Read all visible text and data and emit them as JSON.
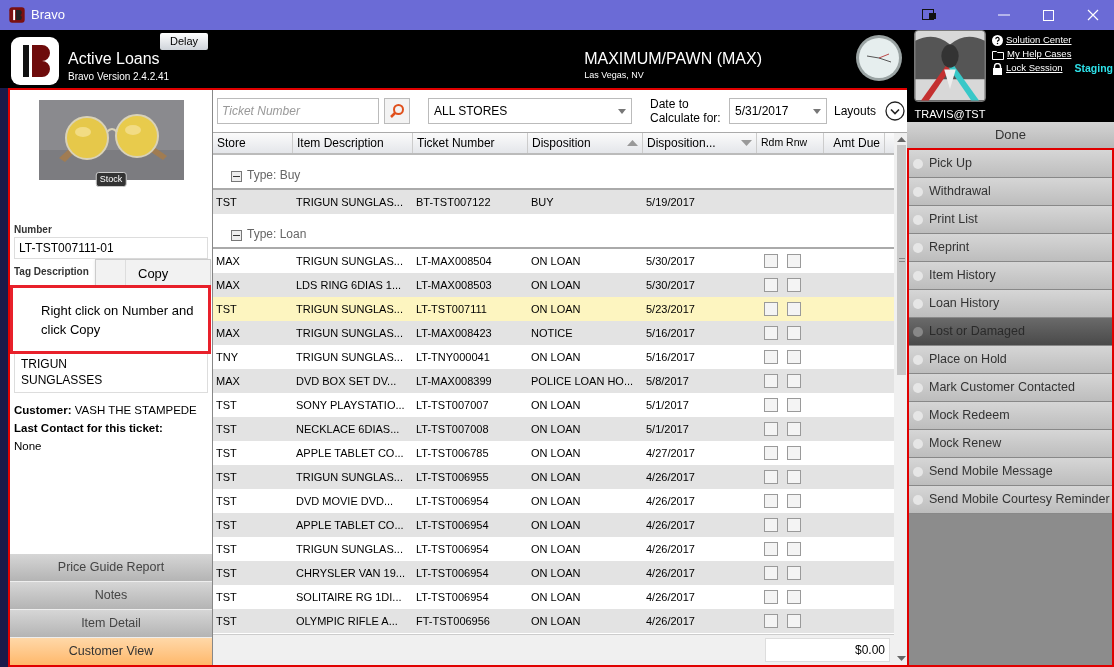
{
  "window": {
    "title": "Bravo"
  },
  "header": {
    "app_title": "Active Loans",
    "version": "Bravo Version 2.4.2.41",
    "delay_button": "Delay",
    "store_name": "MAXIMUM/PAWN (MAX)",
    "store_location": "Las Vegas, NV",
    "user": "TRAVIS@TST",
    "environment": "Staging",
    "links": [
      {
        "label": "Solution Center"
      },
      {
        "label": "My Help Cases"
      },
      {
        "label": "Lock Session"
      }
    ]
  },
  "item_panel": {
    "photo_badge": "Stock",
    "number_label": "Number",
    "number": "LT-TST007111-01",
    "tag_label": "Tag Description",
    "tag_description": [
      "TRIGUN",
      "SUNGLASSES"
    ],
    "customer_label": "Customer:",
    "customer": "VASH THE STAMPEDE",
    "last_contact_label": "Last Contact for this ticket:",
    "last_contact": "None"
  },
  "context_menu": {
    "items": [
      "Copy"
    ]
  },
  "annotation": "Right click on Number and click Copy",
  "left_buttons": [
    {
      "label": "Price Guide Report",
      "selected": false
    },
    {
      "label": "Notes",
      "selected": false
    },
    {
      "label": "Item Detail",
      "selected": false
    },
    {
      "label": "Customer View",
      "selected": true
    }
  ],
  "toolbar": {
    "ticket_placeholder": "Ticket Number",
    "store_filter": "ALL STORES",
    "date_label": "Date to Calculate for:",
    "date": "5/31/2017",
    "layouts_label": "Layouts"
  },
  "table": {
    "columns": [
      {
        "label": "Store",
        "sorted": false
      },
      {
        "label": "Item Description",
        "sorted": false
      },
      {
        "label": "Ticket Number",
        "sorted": false
      },
      {
        "label": "Disposition",
        "sorted": true,
        "descending": false
      },
      {
        "label": "Disposition...",
        "sorted": true,
        "descending": true
      },
      {
        "label": "Rdm Rnw",
        "sorted": false
      },
      {
        "label": "Amt Due",
        "sorted": false
      }
    ],
    "groups": [
      {
        "label": "Type: Buy",
        "expanded": true,
        "rows": [
          {
            "store": "TST",
            "item": "TRIGUN SUNGLAS...",
            "ticket": "BT-TST007122",
            "disposition": "BUY",
            "date": "5/19/2017",
            "selected": false
          }
        ]
      },
      {
        "label": "Type: Loan",
        "expanded": true,
        "rows": [
          {
            "store": "MAX",
            "item": "TRIGUN SUNGLAS...",
            "ticket": "LT-MAX008504",
            "disposition": "ON LOAN",
            "date": "5/30/2017",
            "selected": false,
            "redeem": false,
            "renew": false
          },
          {
            "store": "MAX",
            "item": "LDS RING 6DIAS 1...",
            "ticket": "LT-MAX008503",
            "disposition": "ON LOAN",
            "date": "5/30/2017",
            "selected": false,
            "redeem": false,
            "renew": false
          },
          {
            "store": "TST",
            "item": "TRIGUN SUNGLAS...",
            "ticket": "LT-TST007111",
            "disposition": "ON LOAN",
            "date": "5/23/2017",
            "selected": true,
            "redeem": false,
            "renew": false
          },
          {
            "store": "MAX",
            "item": "TRIGUN SUNGLAS...",
            "ticket": "LT-MAX008423",
            "disposition": "NOTICE",
            "date": "5/16/2017",
            "selected": false,
            "redeem": false,
            "renew": false
          },
          {
            "store": "TNY",
            "item": "TRIGUN SUNGLAS...",
            "ticket": "LT-TNY000041",
            "disposition": "ON LOAN",
            "date": "5/16/2017",
            "selected": false,
            "redeem": false,
            "renew": false
          },
          {
            "store": "MAX",
            "item": "DVD BOX SET DV...",
            "ticket": "LT-MAX008399",
            "disposition": "POLICE LOAN HO...",
            "date": "5/8/2017",
            "selected": false,
            "redeem": false,
            "renew": false
          },
          {
            "store": "TST",
            "item": "SONY PLAYSTATIO...",
            "ticket": "LT-TST007007",
            "disposition": "ON LOAN",
            "date": "5/1/2017",
            "selected": false,
            "redeem": false,
            "renew": false
          },
          {
            "store": "TST",
            "item": "NECKLACE 6DIAS...",
            "ticket": "LT-TST007008",
            "disposition": "ON LOAN",
            "date": "5/1/2017",
            "selected": false,
            "redeem": false,
            "renew": false
          },
          {
            "store": "TST",
            "item": "APPLE TABLET CO...",
            "ticket": "LT-TST006785",
            "disposition": "ON LOAN",
            "date": "4/27/2017",
            "selected": false,
            "redeem": false,
            "renew": false
          },
          {
            "store": "TST",
            "item": "TRIGUN SUNGLAS...",
            "ticket": "LT-TST006955",
            "disposition": "ON LOAN",
            "date": "4/26/2017",
            "selected": false,
            "redeem": false,
            "renew": false
          },
          {
            "store": "TST",
            "item": "DVD MOVIE DVD...",
            "ticket": "LT-TST006954",
            "disposition": "ON LOAN",
            "date": "4/26/2017",
            "selected": false,
            "redeem": false,
            "renew": false
          },
          {
            "store": "TST",
            "item": "APPLE TABLET CO...",
            "ticket": "LT-TST006954",
            "disposition": "ON LOAN",
            "date": "4/26/2017",
            "selected": false,
            "redeem": false,
            "renew": false
          },
          {
            "store": "TST",
            "item": "TRIGUN SUNGLAS...",
            "ticket": "LT-TST006954",
            "disposition": "ON LOAN",
            "date": "4/26/2017",
            "selected": false,
            "redeem": false,
            "renew": false
          },
          {
            "store": "TST",
            "item": "CHRYSLER VAN 19...",
            "ticket": "LT-TST006954",
            "disposition": "ON LOAN",
            "date": "4/26/2017",
            "selected": false,
            "redeem": false,
            "renew": false
          },
          {
            "store": "TST",
            "item": "SOLITAIRE RG 1DI...",
            "ticket": "LT-TST006954",
            "disposition": "ON LOAN",
            "date": "4/26/2017",
            "selected": false,
            "redeem": false,
            "renew": false
          },
          {
            "store": "TST",
            "item": "OLYMPIC RIFLE A...",
            "ticket": "FT-TST006956",
            "disposition": "ON LOAN",
            "date": "4/26/2017",
            "selected": false,
            "redeem": false,
            "renew": false
          }
        ]
      }
    ],
    "total": "$0.00"
  },
  "actions": {
    "done": "Done",
    "items": [
      {
        "label": "Pick Up",
        "disabled": false
      },
      {
        "label": "Withdrawal",
        "disabled": false
      },
      {
        "label": "Print List",
        "disabled": false
      },
      {
        "label": "Reprint",
        "disabled": false
      },
      {
        "label": "Item History",
        "disabled": false
      },
      {
        "label": "Loan History",
        "disabled": false
      },
      {
        "label": "Lost or Damaged",
        "disabled": true
      },
      {
        "label": "Place on Hold",
        "disabled": false
      },
      {
        "label": "Mark Customer Contacted",
        "disabled": false
      },
      {
        "label": "Mock Redeem",
        "disabled": false
      },
      {
        "label": "Mock Renew",
        "disabled": false
      },
      {
        "label": "Send Mobile Message",
        "disabled": false
      },
      {
        "label": "Send Mobile Courtesy Reminder",
        "disabled": false
      }
    ]
  }
}
